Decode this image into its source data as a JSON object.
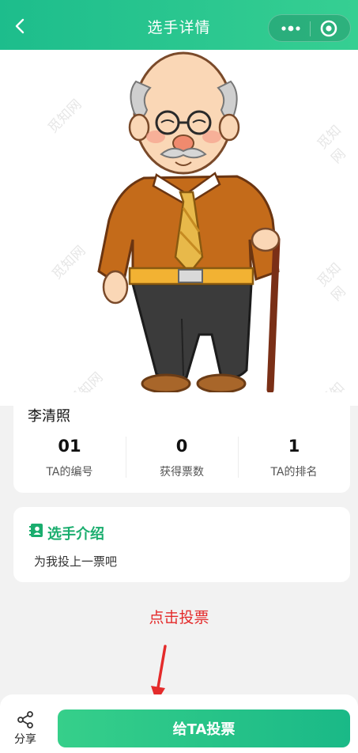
{
  "navbar": {
    "title": "选手详情",
    "back_icon": "chevron-left-icon",
    "more_icon": "more-dots-icon",
    "close_icon": "target-close-icon"
  },
  "hero": {
    "image": "cartoon-old-man-with-cane",
    "watermark": "觅知网"
  },
  "player": {
    "name": "李清照",
    "stats": [
      {
        "value": "01",
        "label": "TA的编号"
      },
      {
        "value": "0",
        "label": "获得票数"
      },
      {
        "value": "1",
        "label": "TA的排名"
      }
    ]
  },
  "intro": {
    "title": "选手介绍",
    "text": "为我投上一票吧",
    "icon": "contact-book-icon"
  },
  "annotation": {
    "text": "点击投票",
    "color": "#e42b2b"
  },
  "bottom": {
    "share_label": "分享",
    "vote_label": "给TA投票"
  },
  "colors": {
    "accent": "#1dbd8c",
    "intro_title": "#1aad6e"
  }
}
